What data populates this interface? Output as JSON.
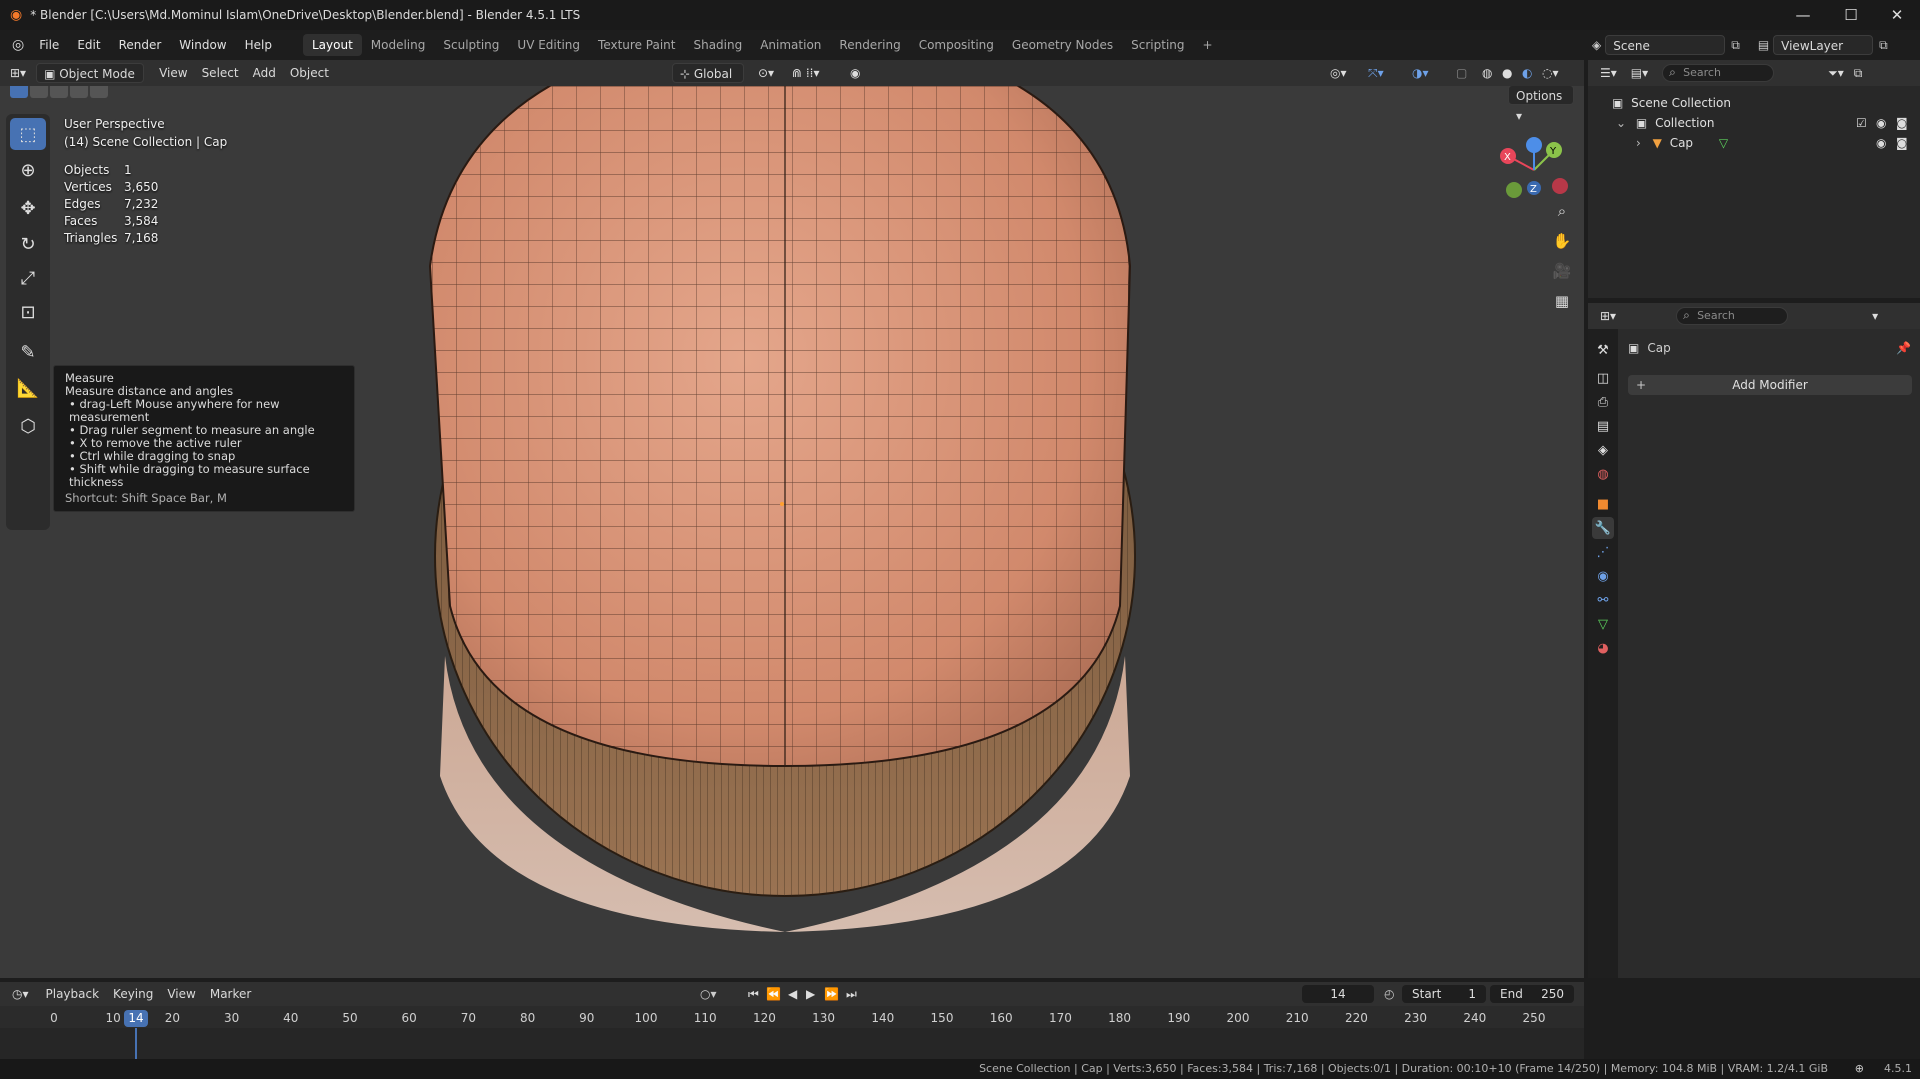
{
  "window": {
    "title": "* Blender [C:\\Users\\Md.Mominul Islam\\OneDrive\\Desktop\\Blender.blend] - Blender 4.5.1 LTS",
    "minimize": "—",
    "maximize": "☐",
    "close": "✕"
  },
  "menu": {
    "items": [
      "File",
      "Edit",
      "Render",
      "Window",
      "Help"
    ],
    "workspaces": [
      "Layout",
      "Modeling",
      "Sculpting",
      "UV Editing",
      "Texture Paint",
      "Shading",
      "Animation",
      "Rendering",
      "Compositing",
      "Geometry Nodes",
      "Scripting"
    ],
    "active_workspace": "Layout",
    "add_workspace": "+",
    "scene_label": "Scene",
    "view_layer_label": "ViewLayer"
  },
  "viewport_header": {
    "mode": "Object Mode",
    "menus": [
      "View",
      "Select",
      "Add",
      "Object"
    ],
    "transform_orientation": "Global",
    "options_label": "Options"
  },
  "viewport": {
    "perspective_label": "User Perspective",
    "context_label": "(14) Scene Collection | Cap",
    "stats": [
      {
        "label": "Objects",
        "value": "1"
      },
      {
        "label": "Vertices",
        "value": "3,650"
      },
      {
        "label": "Edges",
        "value": "7,232"
      },
      {
        "label": "Faces",
        "value": "3,584"
      },
      {
        "label": "Triangles",
        "value": "7,168"
      }
    ],
    "gizmo_axes": {
      "x": "X",
      "y": "Y",
      "z": "Z"
    },
    "axis_colors": {
      "x": "#e8465a",
      "y": "#8bc34a",
      "z": "#4d8ee8"
    }
  },
  "tooltip": {
    "title": "Measure",
    "description": "Measure distance and angles",
    "bullets": [
      "• drag-Left Mouse anywhere for new measurement",
      "• Drag ruler segment to measure an angle",
      "• X to remove the active ruler",
      "• Ctrl while dragging to snap",
      "• Shift while dragging to measure surface thickness"
    ],
    "shortcut": "Shortcut: Shift Space Bar, M"
  },
  "outliner": {
    "search_placeholder": "Search",
    "root": "Scene Collection",
    "collection": "Collection",
    "object": "Cap"
  },
  "properties": {
    "search_placeholder": "Search",
    "object_name": "Cap",
    "add_modifier": "Add Modifier"
  },
  "timeline": {
    "menus": [
      "Playback",
      "Keying",
      "View",
      "Marker"
    ],
    "current_frame": "14",
    "start_label": "Start",
    "start_value": "1",
    "end_label": "End",
    "end_value": "250",
    "ticks": [
      "0",
      "10",
      "20",
      "30",
      "40",
      "50",
      "60",
      "70",
      "80",
      "90",
      "100",
      "110",
      "120",
      "130",
      "140",
      "150",
      "160",
      "170",
      "180",
      "190",
      "200",
      "210",
      "220",
      "230",
      "240",
      "250"
    ],
    "playhead_label": "14"
  },
  "statusbar": {
    "text": "Scene Collection | Cap | Verts:3,650 | Faces:3,584 | Tris:7,168 | Objects:0/1 | Duration: 00:10+10 (Frame 14/250) | Memory: 104.8 MiB | VRAM: 1.2/4.1 GiB",
    "version": "4.5.1"
  },
  "colors": {
    "accent": "#4772b3",
    "active_tool": "#4772b3",
    "playhead": "#4772b3",
    "mesh_skin": "#d9947a",
    "brim": "#8a6a48"
  }
}
